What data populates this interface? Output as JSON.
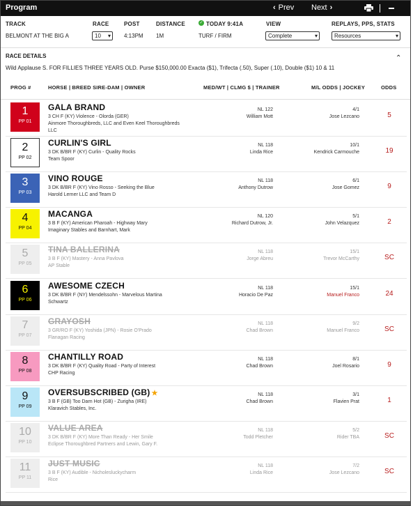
{
  "titlebar": {
    "title": "Program",
    "prev_label": "Prev",
    "next_label": "Next"
  },
  "track": {
    "label": "TRACK",
    "value": "BELMONT AT THE BIG A"
  },
  "race": {
    "label": "RACE",
    "value": "10"
  },
  "post": {
    "label": "POST",
    "value": "4:13PM"
  },
  "distance": {
    "label": "DISTANCE",
    "value": "1M"
  },
  "today": {
    "label": "TODAY 9:41A",
    "surface": "TURF / FIRM"
  },
  "view": {
    "label": "VIEW",
    "value": "Complete"
  },
  "replays": {
    "label": "REPLAYS, PPS, STATS",
    "value": "Resources"
  },
  "race_details": {
    "label": "RACE DETAILS",
    "text": "Wild Applause S. FOR FILLIES THREE YEARS OLD. Purse $150,000.00 Exacta ($1), Trifecta (.50), Super (.10), Double ($1) 10 & 11"
  },
  "headers": {
    "prog": "PROG #",
    "horse": "HORSE | BREED SIRE-DAM | OWNER",
    "medwt": "MED/WT | CLMG $ | TRAINER",
    "mlodds": "M/L ODDS | JOCKEY",
    "odds": "ODDS"
  },
  "entries": [
    {
      "num": "1",
      "pp": "PP 01",
      "name": "GALA BRAND",
      "breed": "3 CH F (KY) Violence - Olorda (GER)",
      "owner": "Ainmore Thoroughbreds, LLC and Even Keel Thoroughbreds LLC",
      "nl": "NL 122",
      "trainer": "William Mott",
      "ml": "4/1",
      "jockey": "Jose Lezcano",
      "odds": "5",
      "bg": "#d0021b",
      "fg": "#ffffff",
      "border": "none",
      "scratched": false
    },
    {
      "num": "2",
      "pp": "PP 02",
      "name": "CURLIN'S GIRL",
      "breed": "3 DK B/BR F (KY) Curlin - Quality Rocks",
      "owner": "Team Spoor",
      "nl": "NL 118",
      "trainer": "Linda Rice",
      "ml": "10/1",
      "jockey": "Kendrick Carmouche",
      "odds": "19",
      "bg": "#ffffff",
      "fg": "#111111",
      "border": "1px solid #333",
      "scratched": false
    },
    {
      "num": "3",
      "pp": "PP 03",
      "name": "VINO ROUGE",
      "breed": "3 DK B/BR F (KY) Vino Rosso - Seeking the Blue",
      "owner": "Harold Lerner LLC and Team D",
      "nl": "NL 118",
      "trainer": "Anthony Dutrow",
      "ml": "6/1",
      "jockey": "Jose Gomez",
      "odds": "9",
      "bg": "#3b63b6",
      "fg": "#ffffff",
      "border": "none",
      "scratched": false
    },
    {
      "num": "4",
      "pp": "PP 04",
      "name": "MACANGA",
      "breed": "3 B F (KY) American Pharoah - Highway Mary",
      "owner": "Imaginary Stables and Barnhart, Mark",
      "nl": "NL 120",
      "trainer": "Richard Dutrow, Jr.",
      "ml": "5/1",
      "jockey": "John Velazquez",
      "odds": "2",
      "bg": "#f7f200",
      "fg": "#111111",
      "border": "none",
      "scratched": false
    },
    {
      "num": "5",
      "pp": "PP 05",
      "name": "TINA BALLERINA",
      "breed": "3 B F (KY) Mastery - Anna Pavlova",
      "owner": "AP Stable",
      "nl": "NL 118",
      "trainer": "Jorge Abreu",
      "ml": "15/1",
      "jockey": "Trevor McCarthy",
      "odds": "SC",
      "bg": "#eeeeee",
      "fg": "#aaaaaa",
      "border": "none",
      "scratched": true
    },
    {
      "num": "6",
      "pp": "PP 06",
      "name": "AWESOME CZECH",
      "breed": "3 DK B/BR F (NY) Mendelssohn - Marvelous Martina",
      "owner": "Schwartz",
      "nl": "NL 118",
      "trainer": "Horacio De Paz",
      "ml": "15/1",
      "jockey": "Manuel Franco",
      "odds": "24",
      "bg": "#000000",
      "fg": "#f7f200",
      "border": "none",
      "scratched": false,
      "jockey_red": true
    },
    {
      "num": "7",
      "pp": "PP 07",
      "name": "GRAYOSH",
      "breed": "3 GR/RO F (KY) Yoshida (JPN) - Rosie O'Prado",
      "owner": "Flanagan Racing",
      "nl": "NL 118",
      "trainer": "Chad Brown",
      "ml": "9/2",
      "jockey": "Manuel Franco",
      "odds": "SC",
      "bg": "#eeeeee",
      "fg": "#aaaaaa",
      "border": "none",
      "scratched": true
    },
    {
      "num": "8",
      "pp": "PP 08",
      "name": "CHANTILLY ROAD",
      "breed": "3 DK B/BR F (KY) Quality Road - Party of Interest",
      "owner": "CHP Racing",
      "nl": "NL 118",
      "trainer": "Chad Brown",
      "ml": "8/1",
      "jockey": "Joel Rosario",
      "odds": "9",
      "bg": "#f79ac0",
      "fg": "#111111",
      "border": "none",
      "scratched": false
    },
    {
      "num": "9",
      "pp": "PP 09",
      "name": "OVERSUBSCRIBED (GB)",
      "breed": "3 B F (GB) Too Darn Hot (GB) - Zurigha (IRE)",
      "owner": "Klaravich Stables, Inc.",
      "nl": "NL 118",
      "trainer": "Chad Brown",
      "ml": "3/1",
      "jockey": "Flavien Prat",
      "odds": "1",
      "bg": "#b9e6f7",
      "fg": "#111111",
      "border": "none",
      "scratched": false,
      "star": true
    },
    {
      "num": "10",
      "pp": "PP 10",
      "name": "VALUE AREA",
      "breed": "3 DK B/BR F (KY) More Than Ready - Her Smile",
      "owner": "Eclipse Thoroughbred Partners and Lewin, Gary F.",
      "nl": "NL 118",
      "trainer": "Todd Pletcher",
      "ml": "5/2",
      "jockey": "Rider TBA",
      "odds": "SC",
      "bg": "#eeeeee",
      "fg": "#aaaaaa",
      "border": "none",
      "scratched": true
    },
    {
      "num": "11",
      "pp": "PP 11",
      "name": "JUST MUSIC",
      "breed": "3 B F (KY) Audible - Nicholesluckycharm",
      "owner": "Rice",
      "nl": "NL 118",
      "trainer": "Linda Rice",
      "ml": "7/2",
      "jockey": "Jose Lezcano",
      "odds": "SC",
      "bg": "#eeeeee",
      "fg": "#aaaaaa",
      "border": "none",
      "scratched": true
    }
  ]
}
